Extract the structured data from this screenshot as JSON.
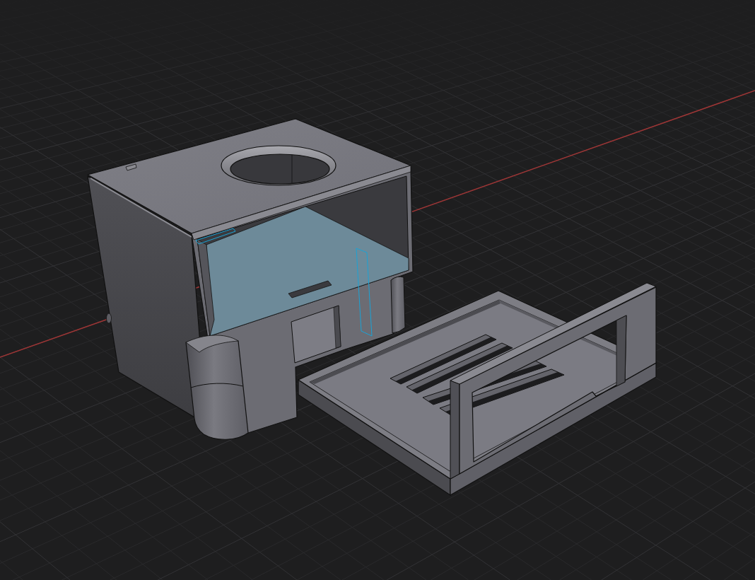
{
  "viewport": {
    "parts": [
      {
        "kind": "housing",
        "selected": true
      },
      {
        "kind": "tray",
        "selected": false
      }
    ]
  }
}
